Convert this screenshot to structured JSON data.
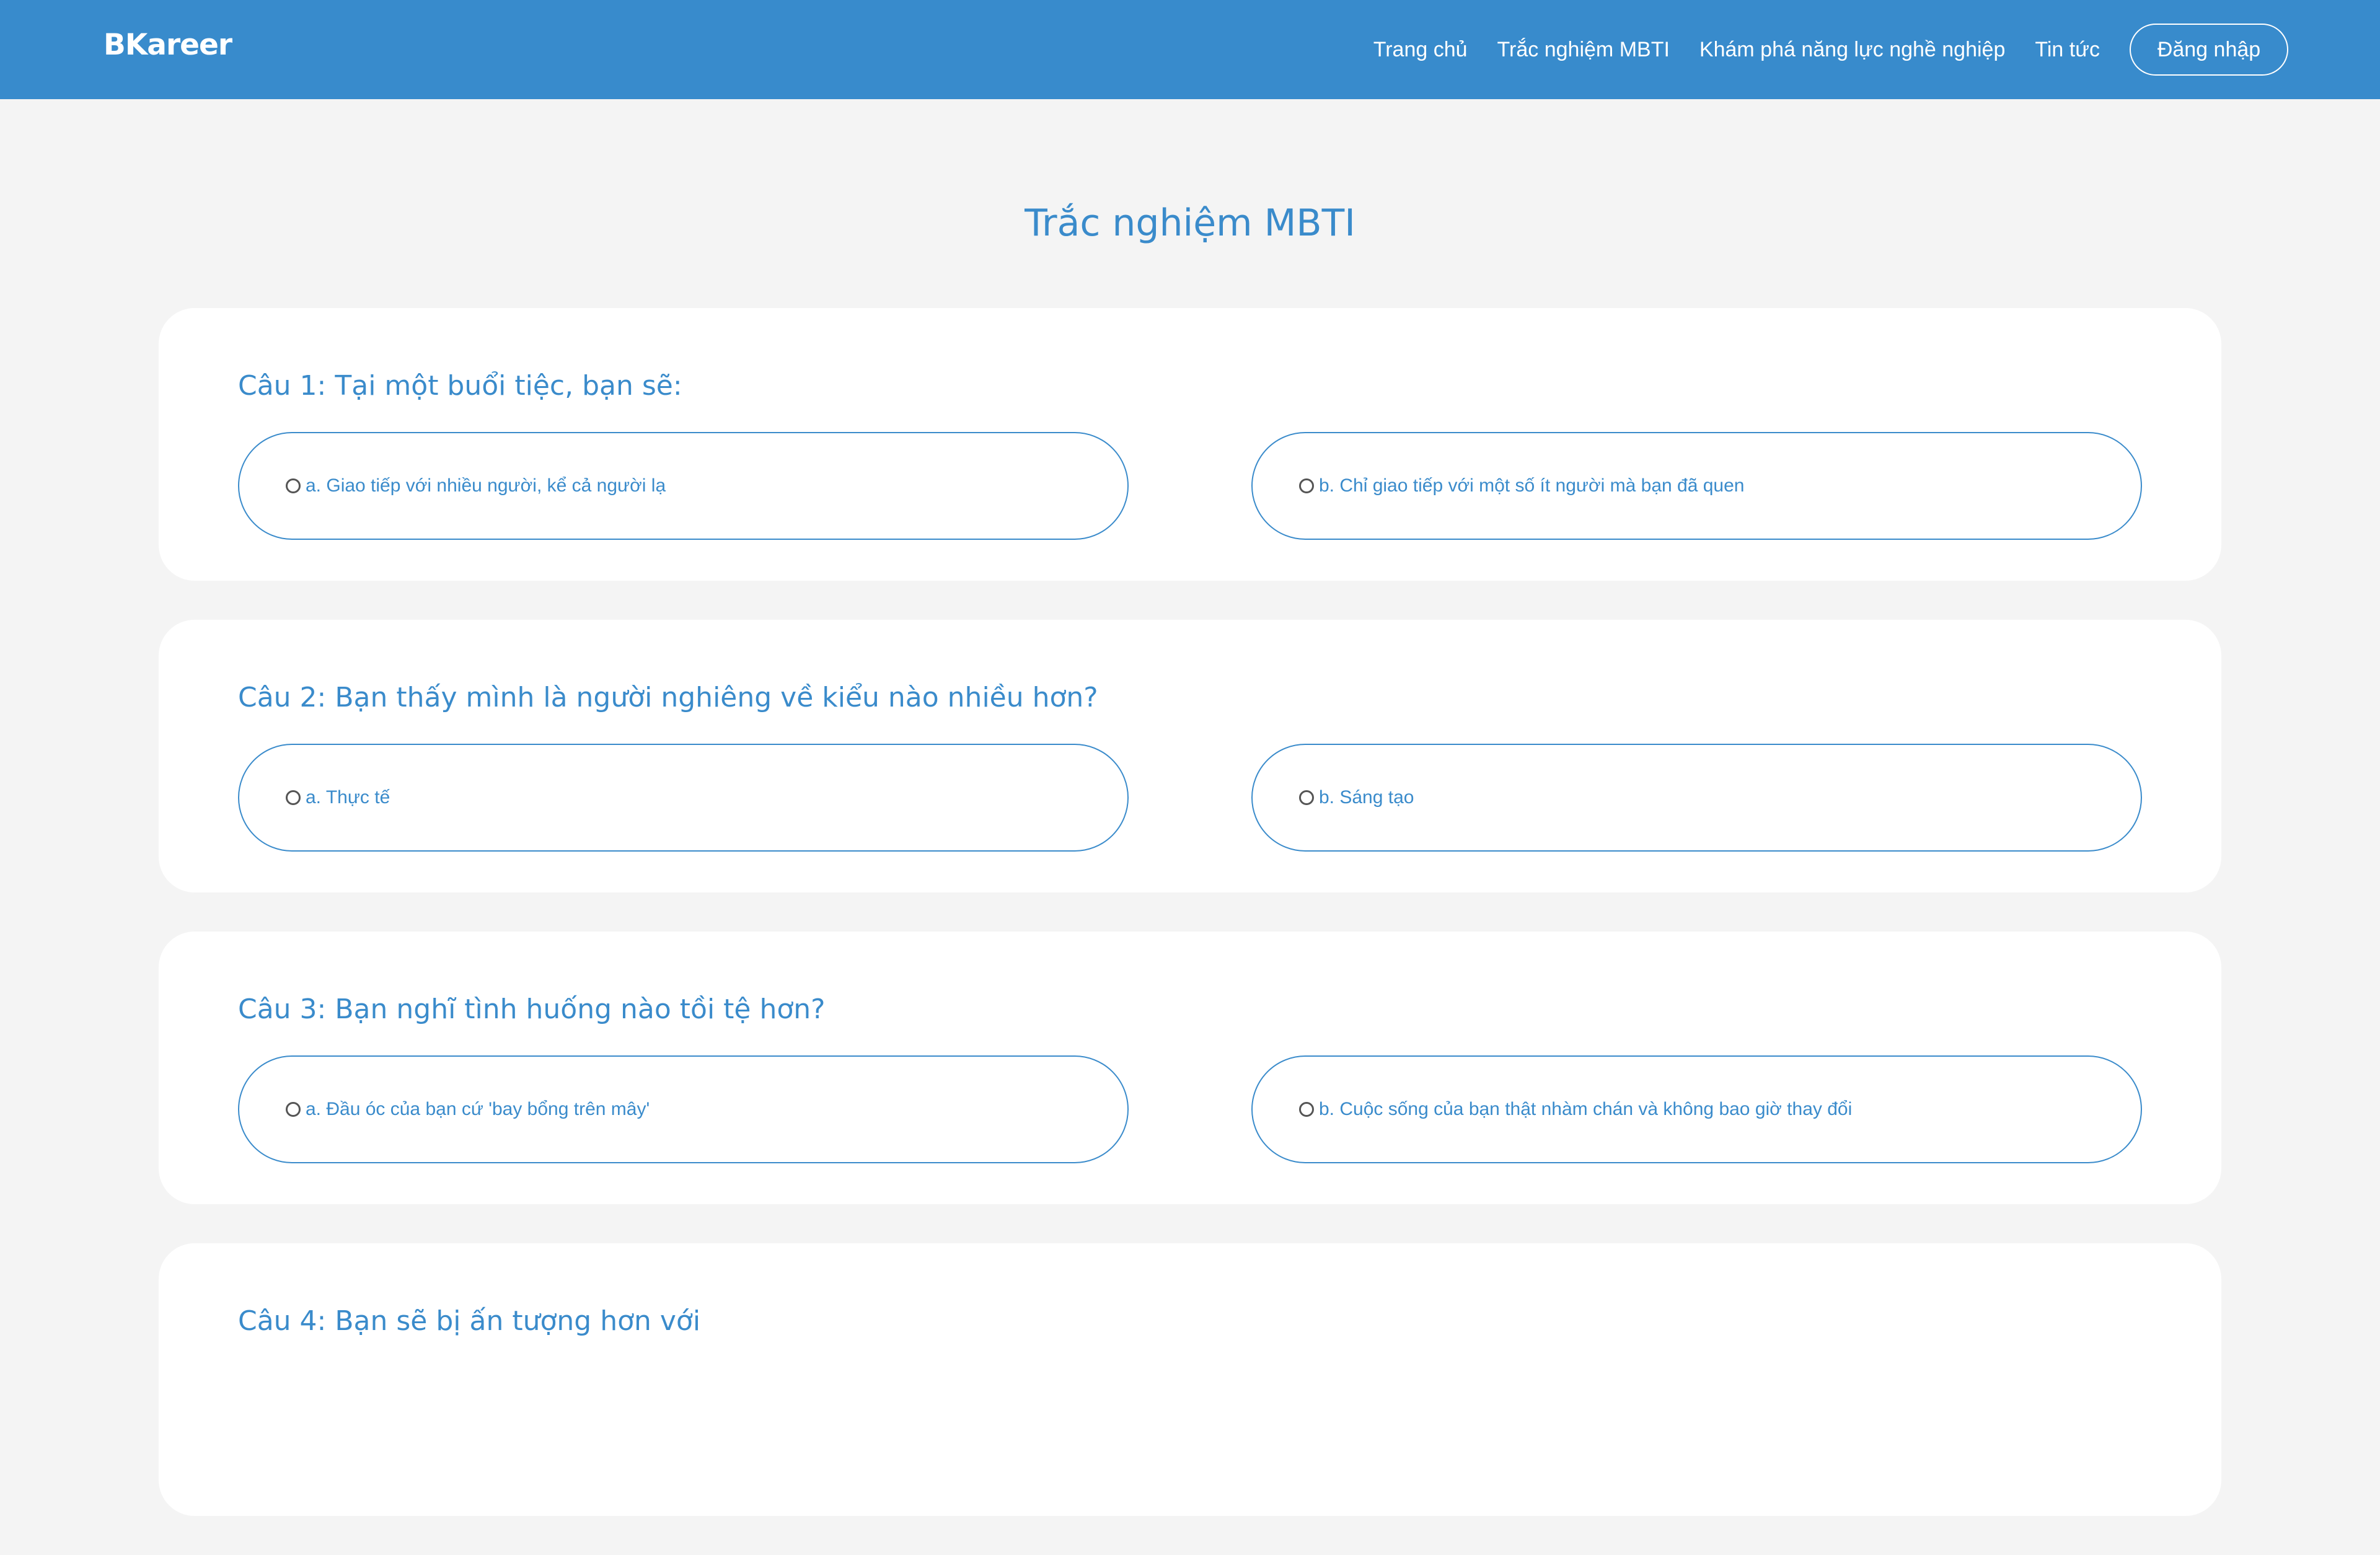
{
  "header": {
    "logo": "BKareer",
    "nav": [
      {
        "label": "Trang chủ"
      },
      {
        "label": "Trắc nghiệm MBTI"
      },
      {
        "label": "Khám phá năng lực nghề nghiệp"
      },
      {
        "label": "Tin tức"
      }
    ],
    "login_label": "Đăng nhập",
    "background_color": "#388bcc"
  },
  "main": {
    "title": "Trắc nghiệm MBTI",
    "accent_color": "#3a8bcb",
    "questions": [
      {
        "text": "Câu 1: Tại một buổi tiệc, bạn sẽ:",
        "option_a": "a. Giao tiếp với nhiều người, kể cả người lạ",
        "option_b": "b. Chỉ giao tiếp với một số ít người mà bạn đã quen"
      },
      {
        "text": "Câu 2: Bạn thấy mình là người nghiêng về kiểu nào nhiều hơn?",
        "option_a": "a. Thực tế",
        "option_b": "b. Sáng tạo"
      },
      {
        "text": "Câu 3: Bạn nghĩ tình huống nào tồi tệ hơn?",
        "option_a": "a. Đầu óc của bạn cứ 'bay bổng trên mây'",
        "option_b": "b. Cuộc sống của bạn thật nhàm chán và không bao giờ thay đổi"
      },
      {
        "text": "Câu 4: Bạn sẽ bị ấn tượng hơn với"
      }
    ]
  }
}
